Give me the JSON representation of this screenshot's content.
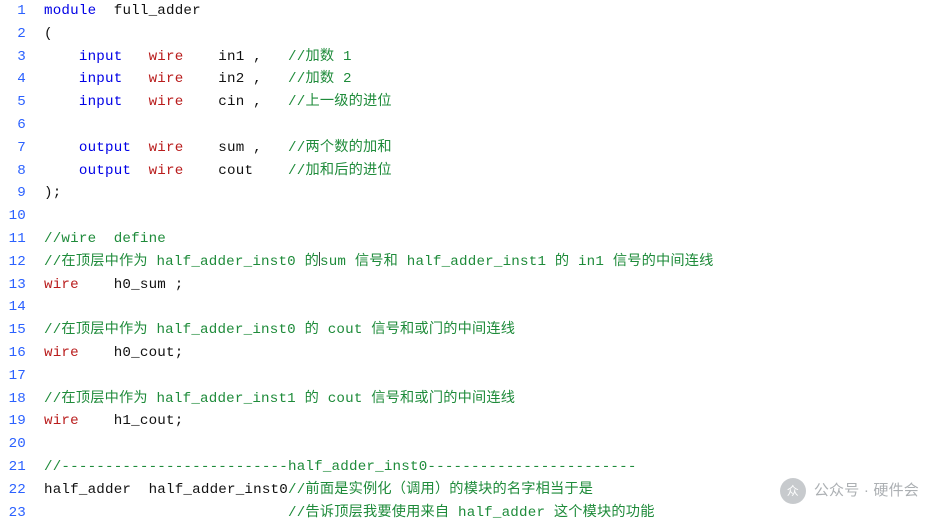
{
  "line_numbers": [
    "1",
    "2",
    "3",
    "4",
    "5",
    "6",
    "7",
    "8",
    "9",
    "10",
    "11",
    "12",
    "13",
    "14",
    "15",
    "16",
    "17",
    "18",
    "19",
    "20",
    "21",
    "22",
    "23"
  ],
  "code_lines": [
    {
      "t": [
        [
          "kw",
          "module"
        ],
        [
          "id",
          "  full_adder"
        ]
      ]
    },
    {
      "t": [
        [
          "pun",
          "("
        ]
      ]
    },
    {
      "t": [
        [
          "id",
          "    "
        ],
        [
          "kw",
          "input"
        ],
        [
          "id",
          "   "
        ],
        [
          "type",
          "wire"
        ],
        [
          "id",
          "    in1 ,   "
        ],
        [
          "cm",
          "//加数 1"
        ]
      ]
    },
    {
      "t": [
        [
          "id",
          "    "
        ],
        [
          "kw",
          "input"
        ],
        [
          "id",
          "   "
        ],
        [
          "type",
          "wire"
        ],
        [
          "id",
          "    in2 ,   "
        ],
        [
          "cm",
          "//加数 2"
        ]
      ]
    },
    {
      "t": [
        [
          "id",
          "    "
        ],
        [
          "kw",
          "input"
        ],
        [
          "id",
          "   "
        ],
        [
          "type",
          "wire"
        ],
        [
          "id",
          "    cin ,   "
        ],
        [
          "cm",
          "//上一级的进位"
        ]
      ]
    },
    {
      "t": []
    },
    {
      "t": [
        [
          "id",
          "    "
        ],
        [
          "kw",
          "output"
        ],
        [
          "id",
          "  "
        ],
        [
          "type",
          "wire"
        ],
        [
          "id",
          "    sum ,   "
        ],
        [
          "cm",
          "//两个数的加和"
        ]
      ]
    },
    {
      "t": [
        [
          "id",
          "    "
        ],
        [
          "kw",
          "output"
        ],
        [
          "id",
          "  "
        ],
        [
          "type",
          "wire"
        ],
        [
          "id",
          "    cout    "
        ],
        [
          "cm",
          "//加和后的进位"
        ]
      ]
    },
    {
      "t": [
        [
          "pun",
          ");"
        ]
      ]
    },
    {
      "t": []
    },
    {
      "t": [
        [
          "cm",
          "//wire  define"
        ]
      ]
    },
    {
      "t": [
        [
          "cm",
          "//在顶层中作为 half_adder_inst0 的"
        ],
        [
          "cursor",
          ""
        ],
        [
          "cm",
          "sum 信号和 half_adder_inst1 的 in1 信号的中间连线"
        ]
      ]
    },
    {
      "t": [
        [
          "type",
          "wire"
        ],
        [
          "id",
          "    h0_sum ;"
        ]
      ]
    },
    {
      "t": []
    },
    {
      "t": [
        [
          "cm",
          "//在顶层中作为 half_adder_inst0 的 cout 信号和或门的中间连线"
        ]
      ]
    },
    {
      "t": [
        [
          "type",
          "wire"
        ],
        [
          "id",
          "    h0_cout;"
        ]
      ]
    },
    {
      "t": []
    },
    {
      "t": [
        [
          "cm",
          "//在顶层中作为 half_adder_inst1 的 cout 信号和或门的中间连线"
        ]
      ]
    },
    {
      "t": [
        [
          "type",
          "wire"
        ],
        [
          "id",
          "    h1_cout;"
        ]
      ]
    },
    {
      "t": []
    },
    {
      "t": [
        [
          "cm",
          "//--------------------------half_adder_inst0------------------------"
        ]
      ]
    },
    {
      "t": [
        [
          "id",
          "half_adder  half_adder_inst0"
        ],
        [
          "cm",
          "//前面是实例化（调用）的模块的名字相当于是"
        ]
      ]
    },
    {
      "t": [
        [
          "id",
          "                            "
        ],
        [
          "cm",
          "//告诉顶层我要使用来自 half_adder 这个模块的功能"
        ]
      ]
    }
  ],
  "watermark": {
    "label": "公众号 · 硬件会",
    "icon": "众"
  }
}
